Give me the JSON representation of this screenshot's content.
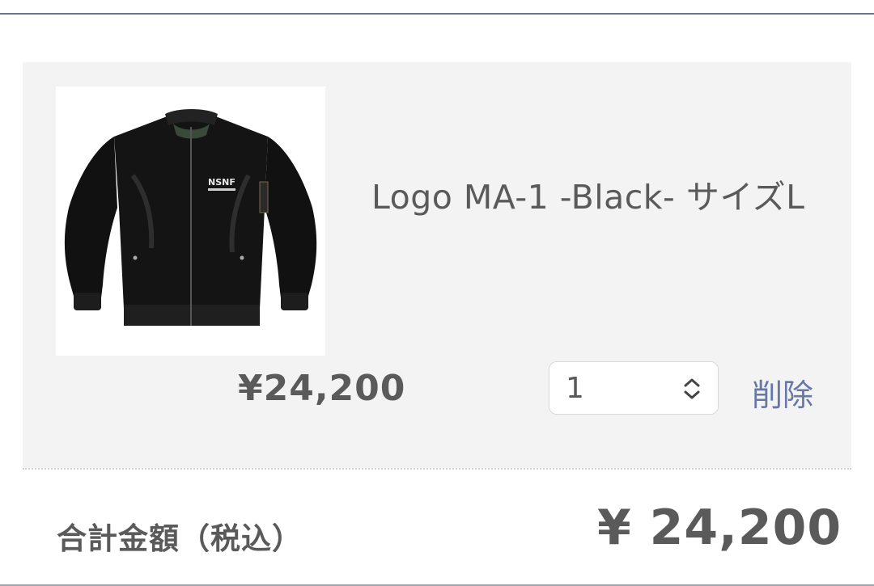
{
  "cart": {
    "item": {
      "name": "Logo MA-1 -Black- サイズL",
      "price": "¥24,200",
      "quantity": "1",
      "delete_label": "削除",
      "image_icon": "jacket-product-image",
      "image_logo_text": "NSNF"
    },
    "total": {
      "label": "合計金額（税込）",
      "value": "¥ 24,200"
    }
  },
  "colors": {
    "text": "#5a5a5a",
    "link": "#6777a8",
    "panel": "#f3f3f3",
    "rule": "#6b7694"
  }
}
